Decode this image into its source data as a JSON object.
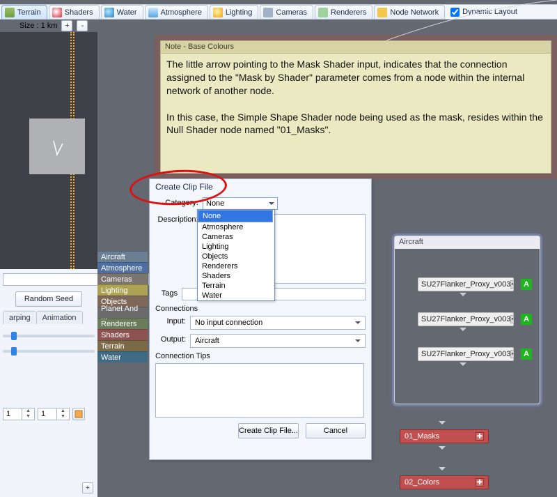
{
  "toolbar": {
    "tabs": [
      "Terrain",
      "Shaders",
      "Water",
      "Atmosphere",
      "Lighting",
      "Cameras",
      "Renderers",
      "Node Network"
    ],
    "dynamic_layout_label": "Dynamic Layout",
    "dynamic_layout_checked": true
  },
  "size_row": {
    "label": "Size : 1 km",
    "plus": "+",
    "minus": "-"
  },
  "prop_panel": {
    "random_seed": "Random Seed",
    "tabs": [
      "arping",
      "Animation"
    ],
    "spin1": "1",
    "spin2": "1"
  },
  "categories": [
    "Aircraft",
    "Atmosphere",
    "Cameras",
    "Lighting",
    "Objects",
    "Planet And ...",
    "Renderers",
    "Shaders",
    "Terrain",
    "Water"
  ],
  "note": {
    "title": "Note - Base Colours",
    "p1": "The little arrow pointing to the Mask Shader input, indicates that the connection assigned to the \"Mask by Shader\" parameter comes from a node within the internal network of another node.",
    "p2": "In this case, the Simple Shape Shader node being used as the mask, resides within the Null Shader node named \"01_Masks\"."
  },
  "dialog": {
    "title": "Create Clip File",
    "category_label": "Category:",
    "category_value": "None",
    "category_options": [
      "None",
      "Atmosphere",
      "Cameras",
      "Lighting",
      "Objects",
      "Renderers",
      "Shaders",
      "Terrain",
      "Water"
    ],
    "description_label": "Description:",
    "tags_label": "Tags",
    "connections_label": "Connections",
    "input_label": "Input:",
    "input_value": "No input connection",
    "output_label": "Output:",
    "output_value": "Aircraft",
    "tips_label": "Connection Tips",
    "create_btn": "Create Clip File...",
    "cancel_btn": "Cancel"
  },
  "network": {
    "group_title": "Aircraft",
    "node_label": "SU27Flanker_Proxy_v003",
    "a_badge": "A",
    "masks": "01_Masks",
    "colors": "02_Colors"
  }
}
